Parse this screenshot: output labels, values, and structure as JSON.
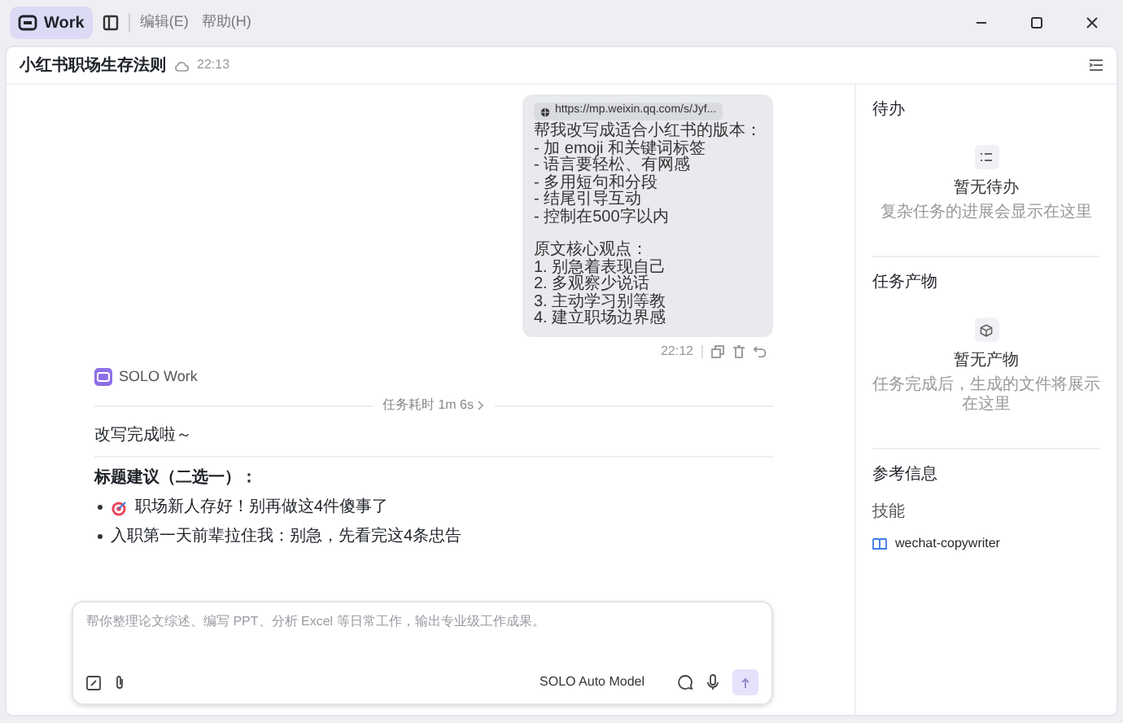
{
  "titlebar": {
    "app_label": "Work",
    "menus": [
      {
        "label": "编辑(E)"
      },
      {
        "label": "帮助(H)"
      }
    ]
  },
  "header": {
    "title": "小红书职场生存法则",
    "time": "22:13"
  },
  "user_message": {
    "link": "https://mp.weixin.qq.com/s/Jyf...",
    "request_lines": [
      "帮我改写成适合小红书的版本：",
      "- 加 emoji 和关键词标签",
      "- 语言要轻松、有网感",
      "- 多用短句和分段",
      "- 结尾引导互动",
      "- 控制在500字以内"
    ],
    "point_lines": [
      "原文核心观点：",
      "1. 别急着表现自己",
      "2. 多观察少说话",
      "3. 主动学习别等教",
      "4. 建立职场边界感"
    ],
    "time": "22:12"
  },
  "assistant": {
    "name": "SOLO Work",
    "duration": "任务耗时 1m 6s",
    "intro": "改写完成啦～",
    "heading": "标题建议（二选一）：",
    "bullets": [
      {
        "kind": "target",
        "text": "职场新人存好！别再做这4件傻事了"
      },
      {
        "kind": "plain",
        "text": "入职第一天前辈拉住我：别急，先看完这4条忠告"
      }
    ]
  },
  "composer": {
    "placeholder": "帮你整理论文综述、编写 PPT、分析 Excel 等日常工作，输出专业级工作成果。",
    "model": "SOLO Auto Model"
  },
  "sidebar": {
    "sections": [
      {
        "kind": "empty",
        "title": "待办",
        "empty_title": "暂无待办",
        "empty_text": "复杂任务的进展会显示在这里"
      },
      {
        "kind": "empty",
        "title": "任务产物",
        "empty_title": "暂无产物",
        "empty_text": "任务完成后，生成的文件将展示在这里"
      },
      {
        "kind": "reference",
        "title": "参考信息",
        "label": "技能",
        "skill": "wechat-copywriter"
      }
    ]
  }
}
